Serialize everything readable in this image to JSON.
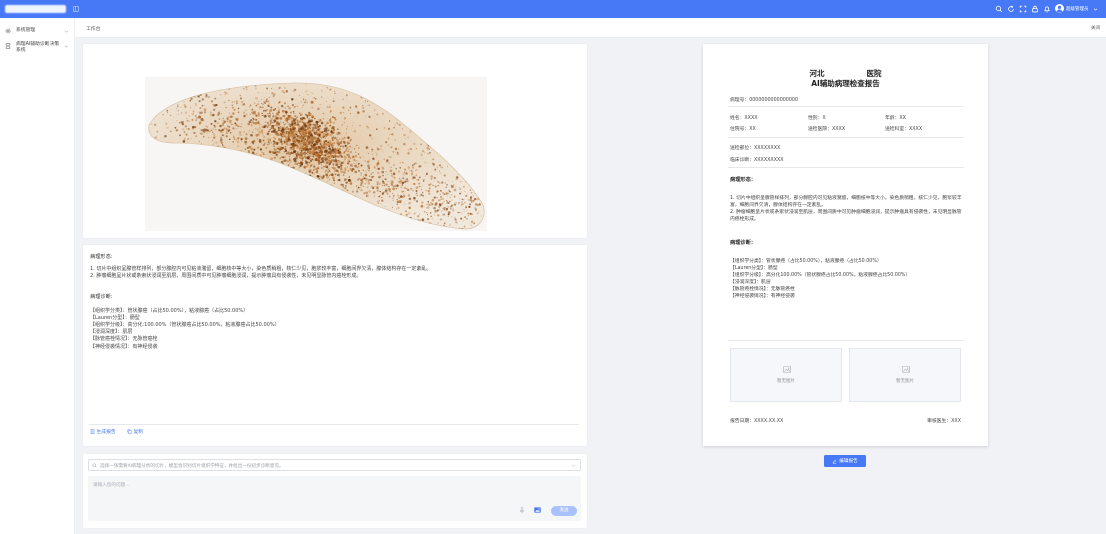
{
  "theme": {
    "primary": "#4778f5",
    "send_disabled": "#a9c2fb"
  },
  "topbar": {
    "icons": [
      "search-icon",
      "refresh-icon",
      "fullscreen-icon",
      "lock-icon",
      "bell-icon"
    ],
    "username": "超级管理员"
  },
  "sidebar": {
    "items": [
      {
        "label": "系统管理",
        "icon": "gear-icon"
      },
      {
        "label": "病理AI辅助诊断决策系统",
        "icon": "document-icon"
      }
    ]
  },
  "tabs": {
    "current": "工作台",
    "close_label": "关闭"
  },
  "analysis": {
    "morphology_title": "病理形态:",
    "morphology_lines": [
      "1. 切片中组织呈腺管样排列，部分腺腔内可见粘液潴留，细胞核中等大小，染色质稍粗，核仁少见，胞浆较丰富，细胞间界欠清，腺体结构存在一定紊乱。",
      "2. 肿瘤细胞呈片状或条索状浸润至肌层，周围间质中可见肿瘤细胞浸润，提示肿瘤具有侵袭性，未见明显脉管内癌栓形成。"
    ],
    "diagnosis_title": "病理诊断:",
    "diagnosis_lines": [
      "【组织学分类】：管状腺癌（占比50.00%），粘液腺癌（占比50.00%）",
      "【Lauren分型】：肠型",
      "【组织学分级】：高分化:100.00%（管状腺癌占比50.00%，粘液腺癌占比50.00%）",
      "【浸润深度】：肌层",
      "【脉管癌栓情况】：无脉管癌栓",
      "【神经侵袭情况】：有神经侵袭"
    ],
    "actions": {
      "generate_report": "生成报告",
      "copy": "复制"
    }
  },
  "chat": {
    "select_placeholder": "选择一张需要AI病理分析的切片，模型会识别切片组织学特征，并给出一份初步诊断意见。",
    "input_placeholder": "请输入您的问题...",
    "send_label": "发送"
  },
  "report": {
    "hospital_prefix": "河北",
    "hospital_suffix": "医院",
    "title": "AI辅助病理检查报告",
    "pathology_no": "病理号：0000000000000000",
    "name": "姓名：XXXX",
    "gender": "性别：X",
    "age": "年龄：XX",
    "inpatient_no": "住院号：XX",
    "hospital": "送检医院：XXXX",
    "department": "送检科室：XXXX",
    "site": "送检部位：XXXXXXXX",
    "clinical_diagnosis": "临床诊断：XXXXXXXXX",
    "morphology_title": "病理形态：",
    "morphology_lines": [
      "1. 切片中组织呈腺管样排列，部分腺腔内可见粘液潴留，细胞核中等大小，染色质稍粗，核仁少见，胞浆较丰富，细胞间界欠清，腺体结构存在一定紊乱。",
      "2. 肿瘤细胞呈片状或条索状浸润至肌层，周围间质中可见肿瘤细胞浸润，提示肿瘤具有侵袭性，未见明显脉管内癌栓形成。"
    ],
    "diagnosis_title": "病理诊断：",
    "diagnosis_lines": [
      "【组织学分类】：管状腺癌（占比50.00%），粘液腺癌（占比50.00%）",
      "【Lauren分型】：肠型",
      "【组织学分级】：高分化100.00%（管状腺癌占比50.00%，粘液腺癌占比50.00%）",
      "【浸润深度】：肌层",
      "【脉管癌栓情况】：无脉管癌栓",
      "【神经侵袭情况】：有神经侵袭"
    ],
    "image_placeholders": [
      "暂无图片",
      "暂无图片"
    ],
    "report_date": "报告日期：XXXX.XX.XX",
    "reviewer": "审核医生：XXX",
    "edit_button": "编辑报告"
  }
}
